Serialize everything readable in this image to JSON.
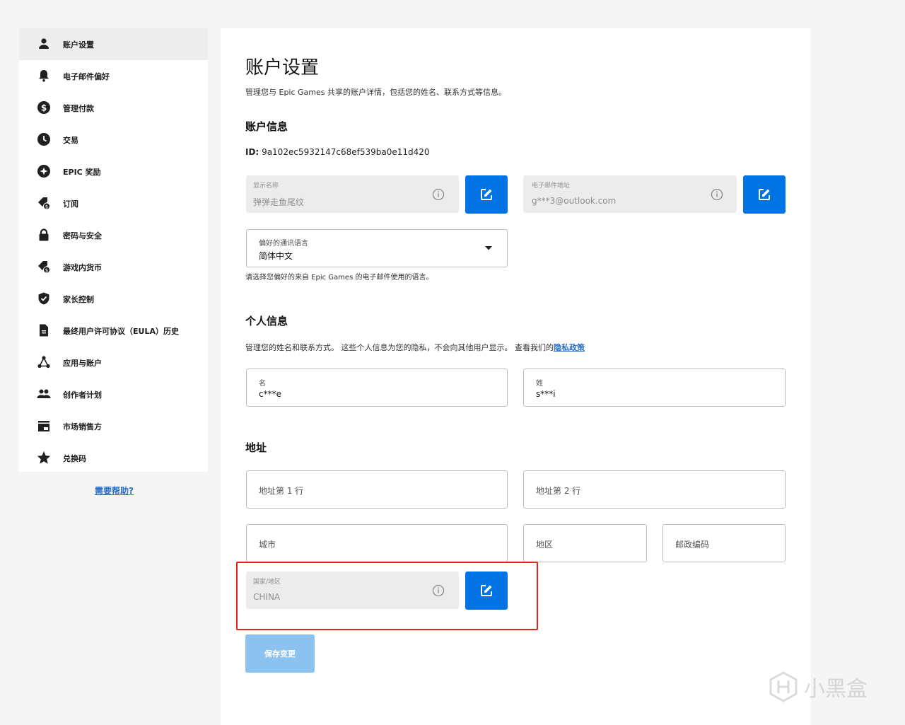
{
  "sidebar": {
    "items": [
      {
        "label": "账户设置",
        "icon": "person-icon",
        "active": true
      },
      {
        "label": "电子邮件偏好",
        "icon": "bell-icon"
      },
      {
        "label": "管理付款",
        "icon": "dollar-icon"
      },
      {
        "label": "交易",
        "icon": "clock-icon"
      },
      {
        "label": "EPIC 奖励",
        "icon": "star-circle-icon"
      },
      {
        "label": "订阅",
        "icon": "subscription-icon"
      },
      {
        "label": "密码与安全",
        "icon": "lock-icon"
      },
      {
        "label": "游戏内货币",
        "icon": "currency-icon"
      },
      {
        "label": "家长控制",
        "icon": "shield-icon"
      },
      {
        "label": "最终用户许可协议（EULA）历史",
        "icon": "document-icon"
      },
      {
        "label": "应用与账户",
        "icon": "apps-icon"
      },
      {
        "label": "创作者计划",
        "icon": "people-icon"
      },
      {
        "label": "市场销售方",
        "icon": "store-icon"
      },
      {
        "label": "兑换码",
        "icon": "star-icon"
      }
    ],
    "help_link": "需要帮助?"
  },
  "main": {
    "title": "账户设置",
    "subtitle": "管理您与 Epic Games 共享的账户详情，包括您的姓名、联系方式等信息。",
    "account_info": {
      "heading": "账户信息",
      "id_label": "ID:",
      "id_value": "9a102ec5932147c68ef539ba0e11d420",
      "display_name": {
        "label": "显示名称",
        "value": "弹弹走鱼尾纹"
      },
      "email": {
        "label": "电子邮件地址",
        "value": "g***3@outlook.com"
      },
      "language": {
        "label": "偏好的通讯语言",
        "value": "简体中文",
        "helper": "请选择您偏好的来自 Epic Games 的电子邮件使用的语言。"
      }
    },
    "personal_info": {
      "heading": "个人信息",
      "description": "管理您的姓名和联系方式。 这些个人信息为您的隐私，不会向其他用户显示。 查看我们的",
      "privacy_link": "隐私政策",
      "first_name": {
        "label": "名",
        "value": "c***e"
      },
      "last_name": {
        "label": "姓",
        "value": "s***i"
      }
    },
    "address": {
      "heading": "地址",
      "line1_placeholder": "地址第 1 行",
      "line2_placeholder": "地址第 2 行",
      "city_placeholder": "城市",
      "region_placeholder": "地区",
      "postal_placeholder": "邮政编码",
      "country": {
        "label": "国家/地区",
        "value": "CHINA"
      }
    },
    "save_label": "保存变更"
  },
  "watermark": "小黑盒",
  "colors": {
    "accent": "#0074e4",
    "highlight": "#e1251b",
    "save_disabled": "#8cc2f0",
    "link": "#2a6ec6"
  }
}
